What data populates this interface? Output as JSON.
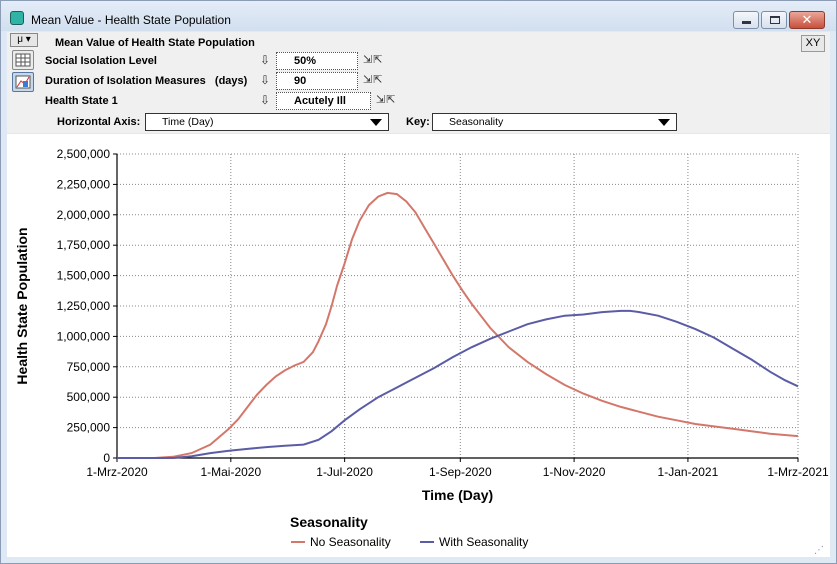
{
  "window": {
    "title": "Mean Value - Health State Population"
  },
  "controls": {
    "mu_label": "μ ▾",
    "heading": "Mean Value of Health State Population",
    "params": [
      {
        "label": "Social Isolation Level",
        "value": "50%"
      },
      {
        "label": "Duration of Isolation Measures",
        "units": "(days)",
        "value": "90"
      },
      {
        "label": "Health State 1",
        "value": "Acutely Ill"
      }
    ],
    "horizontal_axis_label": "Horizontal Axis:",
    "horizontal_axis_value": "Time (Day)",
    "key_label": "Key:",
    "key_value": "Seasonality",
    "xy_label": "XY"
  },
  "chart_data": {
    "type": "line",
    "xlabel": "Time (Day)",
    "ylabel": "Health State Population",
    "ylim": [
      0,
      2500000
    ],
    "y_ticks": [
      "0",
      "250,000",
      "500,000",
      "750,000",
      "1,000,000",
      "1,250,000",
      "1,500,000",
      "1,750,000",
      "2,000,000",
      "2,250,000",
      "2,500,000"
    ],
    "x_ticks": [
      "1-Mrz-2020",
      "1-Mai-2020",
      "1-Jul-2020",
      "1-Sep-2020",
      "1-Nov-2020",
      "1-Jan-2021",
      "1-Mrz-2021"
    ],
    "x_tick_days": [
      0,
      61,
      122,
      184,
      245,
      306,
      365
    ],
    "xlim": [
      0,
      365
    ],
    "grid": true,
    "legend_title": "Seasonality",
    "legend_position": "bottom",
    "series": [
      {
        "name": "No Seasonality",
        "color": "#d4776b",
        "x": [
          0,
          20,
          30,
          40,
          50,
          60,
          65,
          70,
          75,
          80,
          85,
          90,
          95,
          100,
          105,
          108,
          112,
          115,
          118,
          122,
          126,
          130,
          135,
          140,
          145,
          150,
          155,
          160,
          165,
          170,
          175,
          180,
          185,
          190,
          195,
          200,
          210,
          220,
          230,
          240,
          250,
          260,
          270,
          280,
          290,
          300,
          310,
          320,
          330,
          340,
          350,
          365
        ],
        "y": [
          0,
          0,
          10000,
          40000,
          110000,
          240000,
          320000,
          420000,
          520000,
          600000,
          670000,
          720000,
          760000,
          790000,
          870000,
          960000,
          1100000,
          1250000,
          1420000,
          1600000,
          1800000,
          1950000,
          2080000,
          2150000,
          2180000,
          2170000,
          2110000,
          2020000,
          1890000,
          1760000,
          1630000,
          1500000,
          1380000,
          1270000,
          1170000,
          1070000,
          910000,
          790000,
          690000,
          600000,
          530000,
          470000,
          420000,
          380000,
          340000,
          310000,
          280000,
          260000,
          240000,
          220000,
          200000,
          180000
        ]
      },
      {
        "name": "With Seasonality",
        "color": "#5b5ca6",
        "x": [
          0,
          30,
          40,
          50,
          60,
          70,
          80,
          90,
          100,
          108,
          115,
          122,
          130,
          140,
          150,
          160,
          170,
          180,
          190,
          200,
          210,
          220,
          230,
          240,
          250,
          260,
          270,
          275,
          280,
          290,
          300,
          310,
          320,
          330,
          340,
          350,
          358,
          365
        ],
        "y": [
          0,
          0,
          15000,
          40000,
          60000,
          75000,
          90000,
          100000,
          110000,
          150000,
          220000,
          310000,
          400000,
          500000,
          580000,
          660000,
          740000,
          830000,
          910000,
          980000,
          1040000,
          1100000,
          1140000,
          1170000,
          1180000,
          1200000,
          1210000,
          1210000,
          1200000,
          1170000,
          1120000,
          1060000,
          990000,
          900000,
          810000,
          710000,
          640000,
          590000
        ]
      }
    ]
  }
}
